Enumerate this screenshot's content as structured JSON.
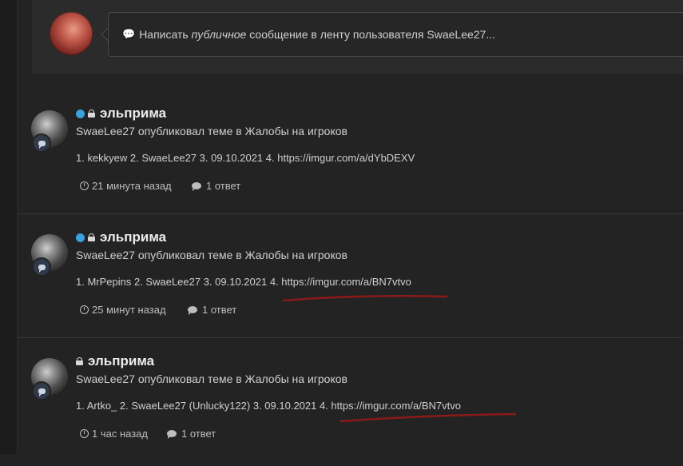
{
  "composer": {
    "prefix": "Написать ",
    "emph": "публичное",
    "suffix": " сообщение в ленту пользователя SwaeLee27..."
  },
  "posts": [
    {
      "username": "эльприма",
      "online": true,
      "subtitle": "SwaeLee27 опубликовал теме в Жалобы на игроков",
      "body": "1. kekkyew 2. SwaeLee27 3. 09.10.2021 4. https://imgur.com/a/dYbDEXV",
      "time": "21 минута назад",
      "replies": "1 ответ",
      "underlined": false
    },
    {
      "username": "эльприма",
      "online": true,
      "subtitle": "SwaeLee27 опубликовал теме в Жалобы на игроков",
      "body": "1. MrPepins 2. SwaeLee27 3. 09.10.2021 4. https://imgur.com/a/BN7vtvo",
      "time": "25 минут назад",
      "replies": "1 ответ",
      "underlined": true
    },
    {
      "username": "эльприма",
      "online": false,
      "subtitle": "SwaeLee27 опубликовал теме в Жалобы на игроков",
      "body": "1. Artko_ 2. SwaeLee27 (Unlucky122) 3. 09.10.2021 4. https://imgur.com/a/BN7vtvo",
      "time": "1 час назад",
      "replies": "1 ответ",
      "underlined": true
    }
  ],
  "colors": {
    "background": "#232323",
    "accent_online": "#3aa0de",
    "annotation_red": "#8a1a1a"
  }
}
